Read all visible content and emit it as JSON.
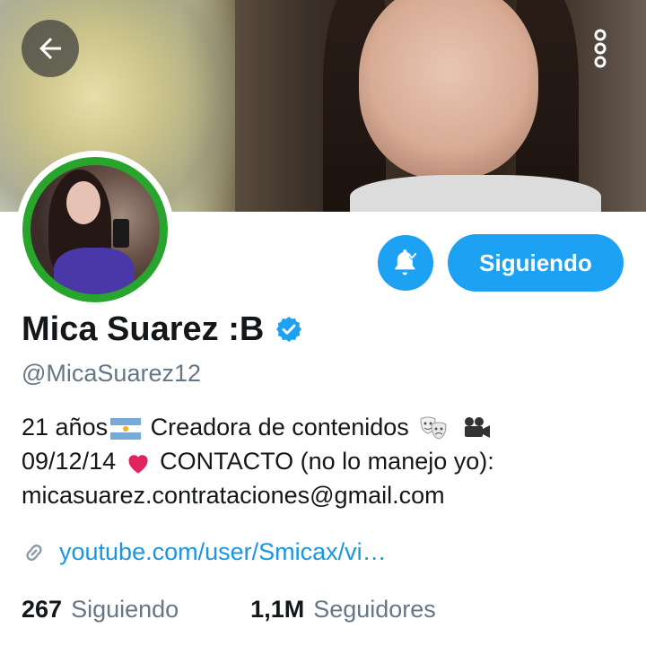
{
  "header": {
    "back_icon": "arrow-left-icon",
    "more_icon": "more-vertical-icon"
  },
  "profile": {
    "name": "Mica Suarez :B",
    "handle": "@MicaSuarez12",
    "verified": true,
    "bio": {
      "line1_a": "21 años",
      "line1_b": "Creadora de contenidos",
      "line2_a": "09/12/14",
      "line2_b": "CONTACTO (no lo manejo yo):",
      "line3": "micasuarez.contrataciones@gmail.com"
    },
    "link": "youtube.com/user/Smicax/vi…"
  },
  "actions": {
    "notifications_icon": "bell-check-icon",
    "follow_label": "Siguiendo"
  },
  "stats": {
    "following_count": "267",
    "following_label": "Siguiendo",
    "followers_count": "1,1M",
    "followers_label": "Seguidores"
  },
  "colors": {
    "accent": "#1da1f2",
    "link": "#1b95e0",
    "muted": "#657786",
    "avatar_ring": "#27a52c",
    "heart": "#e0245e"
  }
}
